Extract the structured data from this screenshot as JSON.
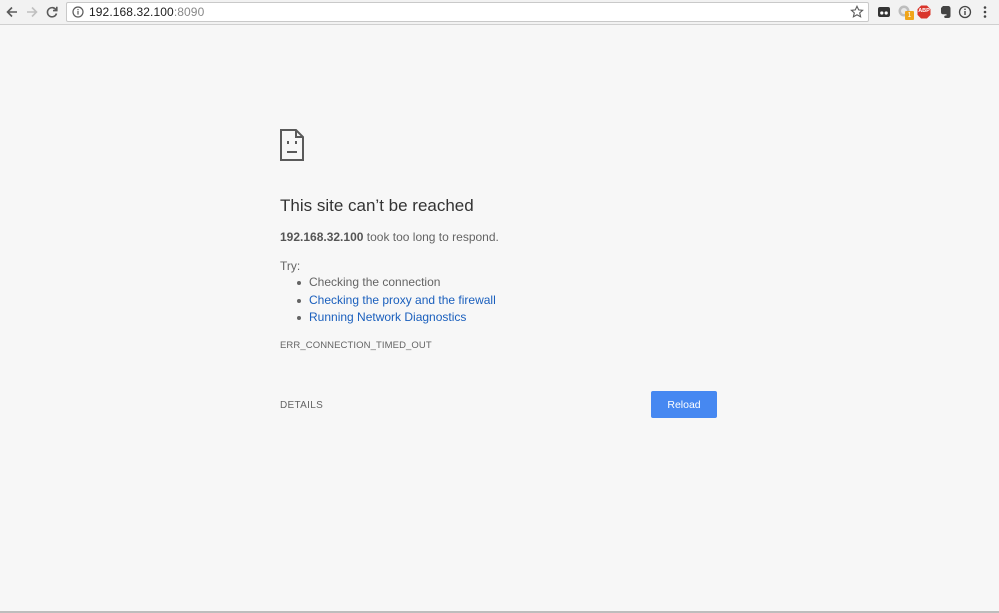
{
  "browser": {
    "url_host": "192.168.32.100",
    "url_port": ":8090",
    "extensions": {
      "abp_label": "ABP",
      "badge_count": "1"
    }
  },
  "error": {
    "title": "This site can’t be reached",
    "host": "192.168.32.100",
    "message": " took too long to respond.",
    "try_label": "Try:",
    "suggestions": [
      "Checking the connection",
      "Checking the proxy and the firewall",
      "Running Network Diagnostics"
    ],
    "code": "ERR_CONNECTION_TIMED_OUT",
    "details_label": "DETAILS",
    "reload_label": "Reload"
  },
  "colors": {
    "accent": "#4688f1",
    "link": "#1a5fbd",
    "abp_red": "#d9352b"
  }
}
